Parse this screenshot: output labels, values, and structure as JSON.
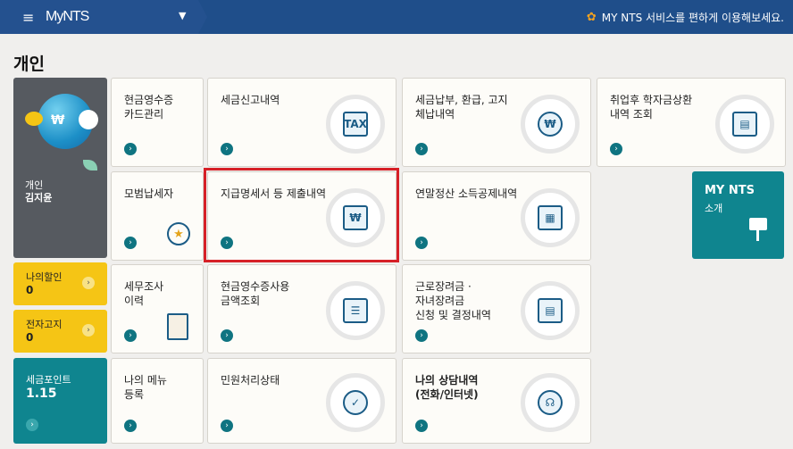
{
  "topbar": {
    "brand": "MyNTS",
    "notice": "MY NTS 서비스를 편하게 이용해보세요."
  },
  "section": {
    "title": "개인"
  },
  "profile": {
    "title": "개인",
    "name": "김지윤"
  },
  "side": {
    "discount": {
      "label": "나의할인",
      "value": "0"
    },
    "notice": {
      "label": "전자고지",
      "value": "0"
    },
    "points": {
      "label": "세금포인트",
      "value": "1.15"
    }
  },
  "tiles": {
    "cash_card": "현금영수증\n카드관리",
    "tax_report": "세금신고내역",
    "tax_payment": "세금납부, 환급, 고지\n체납내역",
    "student_loan": "취업후 학자금상환\n내역 조회",
    "model_taxpayer": "모범납세자",
    "statements": "지급명세서 등 제출내역",
    "year_end": "연말정산 소득공제내역",
    "audit": "세무조사\n이력",
    "cash_receipt_use": "현금영수증사용\n금액조회",
    "earned_income": "근로장려금 ·\n자녀장려금\n신청 및 결정내역",
    "my_menu": "나의 메뉴\n등록",
    "civil": "민원처리상태",
    "consult": "나의 상담내역\n(전화/인터넷)"
  },
  "mynts": {
    "title": "MY NTS",
    "sub": "소개"
  }
}
